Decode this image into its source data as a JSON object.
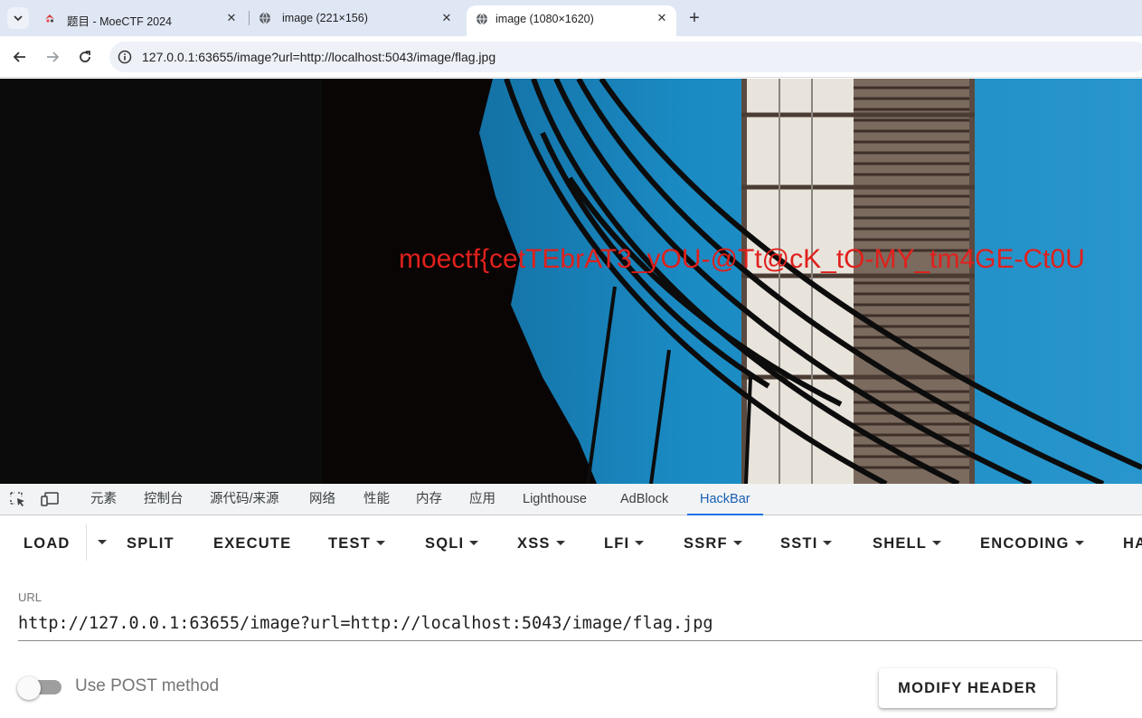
{
  "tabs": [
    {
      "title": "题目 - MoeCTF 2024",
      "favicon": "moectf-icon"
    },
    {
      "title": "image (221×156)",
      "favicon": "globe-icon"
    },
    {
      "title": "image (1080×1620)",
      "favicon": "globe-icon",
      "active": true
    }
  ],
  "address_bar": {
    "url": "127.0.0.1:63655/image?url=http://localhost:5043/image/flag.jpg"
  },
  "page": {
    "flag_text": "moectf{cetTEbrAT3_yOU-@Tt@cK_tO-MY_tm4GE-Ct0U",
    "colors": {
      "sky": "#1b8bc4",
      "flag_text": "#e0201c",
      "background": "#0b0b0b"
    }
  },
  "devtools": {
    "tabs": [
      "元素",
      "控制台",
      "源代码/来源",
      "网络",
      "性能",
      "内存",
      "应用",
      "Lighthouse",
      "AdBlock",
      "HackBar"
    ],
    "active_tab": "HackBar"
  },
  "hackbar": {
    "buttons": [
      "LOAD",
      "SPLIT",
      "EXECUTE",
      "TEST",
      "SQLI",
      "XSS",
      "LFI",
      "SSRF",
      "SSTI",
      "SHELL",
      "ENCODING",
      "HA"
    ],
    "url_label": "URL",
    "url_value": "http://127.0.0.1:63655/image?url=http://localhost:5043/image/flag.jpg",
    "post_label": "Use POST method",
    "post_enabled": false,
    "modify_header_label": "MODIFY HEADER"
  }
}
